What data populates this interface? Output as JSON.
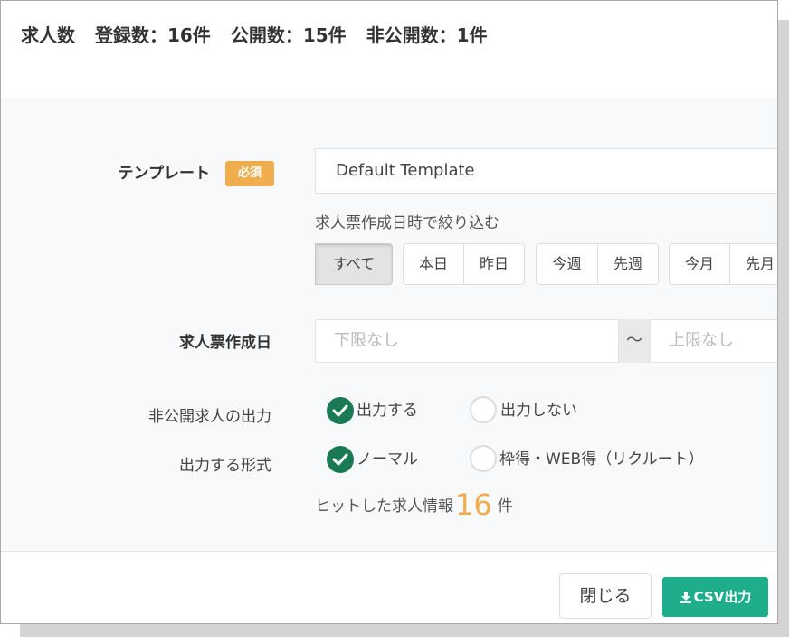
{
  "header": {
    "title": "求人数",
    "registered": "登録数：16件",
    "published": "公開数：15件",
    "unpublished": "非公開数：1件"
  },
  "form": {
    "template": {
      "label": "テンプレート",
      "required_badge": "必須",
      "value": "Default Template"
    },
    "filter": {
      "caption": "求人票作成日時で絞り込む",
      "groups": [
        [
          {
            "label": "すべて",
            "active": true
          }
        ],
        [
          {
            "label": "本日"
          },
          {
            "label": "昨日"
          }
        ],
        [
          {
            "label": "今週"
          },
          {
            "label": "先週"
          }
        ],
        [
          {
            "label": "今月"
          },
          {
            "label": "先月"
          }
        ]
      ]
    },
    "created_date": {
      "label": "求人票作成日",
      "from_placeholder": "下限なし",
      "separator": "〜",
      "to_placeholder": "上限なし"
    },
    "private_output": {
      "label": "非公開求人の出力",
      "options": [
        {
          "label": "出力する",
          "selected": true
        },
        {
          "label": "出力しない",
          "selected": false
        }
      ]
    },
    "output_format": {
      "label": "出力する形式",
      "options": [
        {
          "label": "ノーマル",
          "selected": true
        },
        {
          "label": "枠得・WEB得（リクルート）",
          "selected": false
        }
      ]
    },
    "hits": {
      "prefix": "ヒットした求人情報",
      "count": "16",
      "suffix": "件"
    }
  },
  "footer": {
    "close_label": "閉じる",
    "csv_label": "CSV出力"
  },
  "colors": {
    "accent_green": "#1a7a55",
    "csv_button": "#1fae8c",
    "required_badge": "#f0ad4e",
    "hit_count": "#f0ad4e"
  }
}
